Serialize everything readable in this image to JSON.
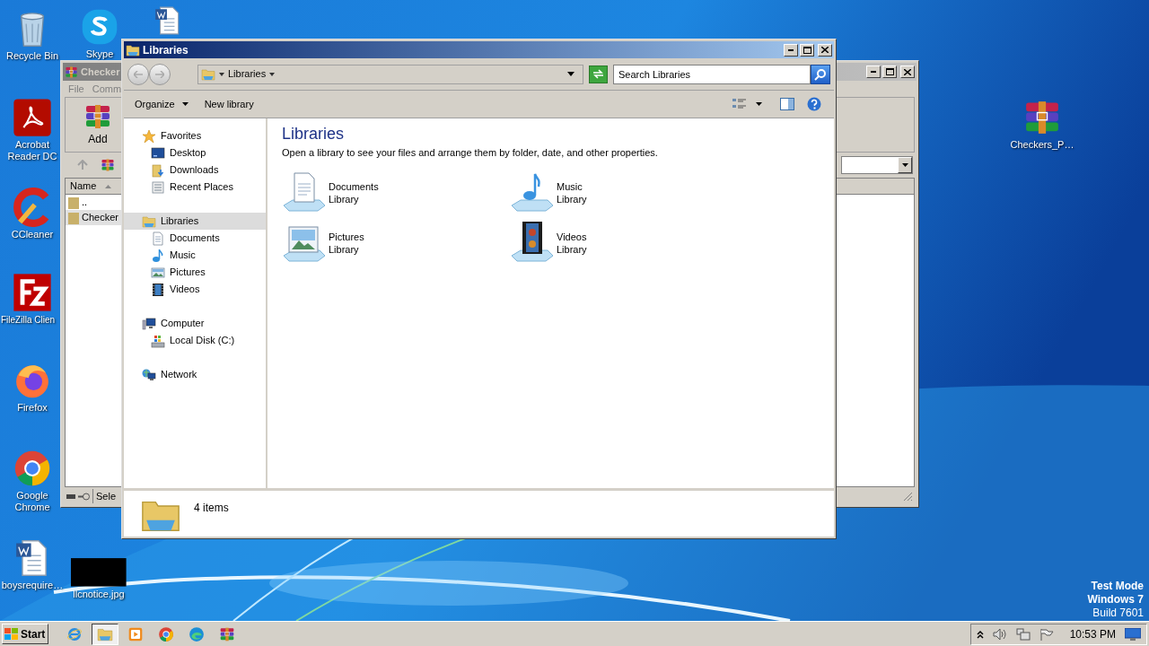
{
  "desktop": {
    "icons": [
      {
        "kind": "recycle-bin",
        "label": "Recycle Bin"
      },
      {
        "kind": "skype",
        "label": "Skype"
      },
      {
        "kind": "word-doc"
      },
      {
        "kind": "acrobat",
        "label": "Acrobat Reader DC"
      },
      {
        "kind": "ccleaner",
        "label": "CCleaner"
      },
      {
        "kind": "filezilla",
        "label": "FileZilla Clien"
      },
      {
        "kind": "firefox",
        "label": "Firefox"
      },
      {
        "kind": "chrome",
        "label": "Google Chrome"
      },
      {
        "kind": "word-doc",
        "label": "boysrequire…"
      },
      {
        "kind": "black-image",
        "label": "llcnotice.jpg"
      },
      {
        "kind": "archive",
        "label": "Checkers_P…"
      }
    ]
  },
  "background_window": {
    "title": "Checker",
    "menu": [
      "File",
      "Comm"
    ],
    "toolbar": [
      "Add"
    ],
    "columns": [
      "Name"
    ],
    "rows": [
      {
        "name": "..",
        "selected": false
      },
      {
        "name": "Checker",
        "selected": true
      }
    ],
    "status": "Sele"
  },
  "explorer": {
    "title": "Libraries",
    "address": "Libraries",
    "search": {
      "placeholder": "Search Libraries"
    },
    "toolbar": [
      {
        "label": "Organize",
        "dropdown": true
      },
      {
        "label": "New library",
        "dropdown": false
      }
    ],
    "nav": [
      {
        "kind": "favorites",
        "label": "Favorites",
        "selected": false,
        "children": [
          {
            "kind": "desktop",
            "label": "Desktop"
          },
          {
            "kind": "downloads",
            "label": "Downloads"
          },
          {
            "kind": "recent",
            "label": "Recent Places"
          }
        ]
      },
      {
        "kind": "libraries",
        "label": "Libraries",
        "selected": true,
        "children": [
          {
            "kind": "documents",
            "label": "Documents"
          },
          {
            "kind": "music",
            "label": "Music"
          },
          {
            "kind": "pictures",
            "label": "Pictures"
          },
          {
            "kind": "videos",
            "label": "Videos"
          }
        ]
      },
      {
        "kind": "computer",
        "label": "Computer",
        "selected": false,
        "children": [
          {
            "kind": "disk",
            "label": "Local Disk (C:)"
          }
        ]
      },
      {
        "kind": "network",
        "label": "Network",
        "selected": false
      }
    ],
    "heading": "Libraries",
    "description": "Open a library to see your files and arrange them by folder, date, and other properties.",
    "items": [
      {
        "kind": "documents",
        "name": "Documents",
        "type": "Library"
      },
      {
        "kind": "music",
        "name": "Music",
        "type": "Library"
      },
      {
        "kind": "pictures",
        "name": "Pictures",
        "type": "Library"
      },
      {
        "kind": "videos",
        "name": "Videos",
        "type": "Library"
      }
    ],
    "details": "4 items"
  },
  "taskbar": {
    "start": "Start",
    "apps": [
      {
        "kind": "ie",
        "selected": false
      },
      {
        "kind": "explorer",
        "selected": true
      },
      {
        "kind": "media",
        "selected": false
      },
      {
        "kind": "chrome",
        "selected": false
      },
      {
        "kind": "edge",
        "selected": false
      },
      {
        "kind": "archive",
        "selected": false
      }
    ],
    "clock": "10:53 PM"
  },
  "system_notice": [
    {
      "text": "Test Mode",
      "bold": true
    },
    {
      "text": "Windows 7",
      "bold": true
    },
    {
      "text": "Build 7601",
      "bold": false
    }
  ]
}
